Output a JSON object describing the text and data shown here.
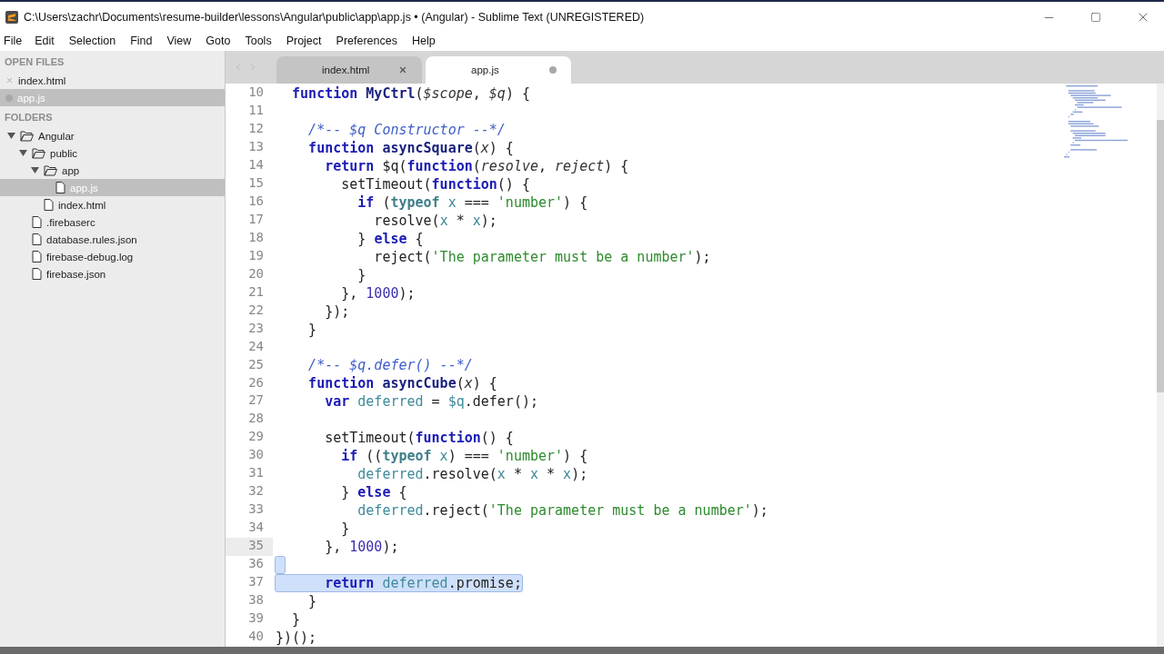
{
  "window": {
    "title": "C:\\Users\\zachr\\Documents\\resume-builder\\lessons\\Angular\\public\\app\\app.js • (Angular) - Sublime Text (UNREGISTERED)"
  },
  "menu": [
    "File",
    "Edit",
    "Selection",
    "Find",
    "View",
    "Goto",
    "Tools",
    "Project",
    "Preferences",
    "Help"
  ],
  "sidebar": {
    "open_files_heading": "OPEN FILES",
    "open_files": [
      {
        "name": "index.html",
        "selected": false,
        "dirty": false
      },
      {
        "name": "app.js",
        "selected": true,
        "dirty": true
      }
    ],
    "folders_heading": "FOLDERS",
    "folders": [
      {
        "name": "Angular",
        "kind": "folder",
        "expanded": true,
        "selected": false,
        "children": [
          {
            "name": "public",
            "kind": "folder",
            "expanded": true,
            "selected": false,
            "children": [
              {
                "name": "app",
                "kind": "folder",
                "expanded": true,
                "selected": false,
                "children": [
                  {
                    "name": "app.js",
                    "kind": "file",
                    "selected": true
                  }
                ]
              },
              {
                "name": "index.html",
                "kind": "file",
                "selected": false
              }
            ]
          },
          {
            "name": ".firebaserc",
            "kind": "file",
            "selected": false
          },
          {
            "name": "database.rules.json",
            "kind": "file",
            "selected": false
          },
          {
            "name": "firebase-debug.log",
            "kind": "file",
            "selected": false
          },
          {
            "name": "firebase.json",
            "kind": "file",
            "selected": false
          }
        ]
      }
    ]
  },
  "tabs": [
    {
      "label": "index.html",
      "selected": false,
      "dirty": false
    },
    {
      "label": "app.js",
      "selected": true,
      "dirty": true
    }
  ],
  "code": [
    {
      "number": "10",
      "current": false,
      "selected": false,
      "tokens": [
        {
          "kind": "kw",
          "text": "  function"
        },
        {
          "kind": "fn",
          "text": " MyCtrl"
        },
        {
          "kind": "p",
          "text": "("
        },
        {
          "kind": "param",
          "text": "$scope"
        },
        {
          "kind": "p",
          "text": ", "
        },
        {
          "kind": "param",
          "text": "$q"
        },
        {
          "kind": "p",
          "text": ") {"
        }
      ]
    },
    {
      "number": "11",
      "current": false,
      "selected": false
    },
    {
      "number": "12",
      "current": false,
      "selected": false,
      "tokens": [
        {
          "kind": "comment",
          "text": "    /*-- $q Constructor --*/"
        }
      ]
    },
    {
      "number": "13",
      "current": false,
      "selected": false,
      "tokens": [
        {
          "kind": "kw",
          "text": "    function"
        },
        {
          "kind": "fn",
          "text": " asyncSquare"
        },
        {
          "kind": "p",
          "text": "("
        },
        {
          "kind": "param",
          "text": "x"
        },
        {
          "kind": "p",
          "text": ") {"
        }
      ]
    },
    {
      "number": "14",
      "current": false,
      "selected": false,
      "tokens": [
        {
          "kind": "kw",
          "text": "      return"
        },
        {
          "kind": "p",
          "text": " $q("
        },
        {
          "kind": "kw",
          "text": "function"
        },
        {
          "kind": "p",
          "text": "("
        },
        {
          "kind": "param",
          "text": "resolve"
        },
        {
          "kind": "p",
          "text": ", "
        },
        {
          "kind": "param",
          "text": "reject"
        },
        {
          "kind": "p",
          "text": ") {"
        }
      ]
    },
    {
      "number": "15",
      "current": false,
      "selected": false,
      "tokens": [
        {
          "kind": "p",
          "text": "        setTimeout("
        },
        {
          "kind": "kw",
          "text": "function"
        },
        {
          "kind": "p",
          "text": "() {"
        }
      ]
    },
    {
      "number": "16",
      "current": false,
      "selected": false,
      "tokens": [
        {
          "kind": "kw",
          "text": "          if"
        },
        {
          "kind": "p",
          "text": " ("
        },
        {
          "kind": "op",
          "text": "typeof"
        },
        {
          "kind": "var",
          "text": " x"
        },
        {
          "kind": "p",
          "text": " === "
        },
        {
          "kind": "str",
          "text": "'number'"
        },
        {
          "kind": "p",
          "text": ") {"
        }
      ]
    },
    {
      "number": "17",
      "current": false,
      "selected": false,
      "tokens": [
        {
          "kind": "p",
          "text": "            resolve("
        },
        {
          "kind": "var",
          "text": "x"
        },
        {
          "kind": "p",
          "text": " * "
        },
        {
          "kind": "var",
          "text": "x"
        },
        {
          "kind": "p",
          "text": ");"
        }
      ]
    },
    {
      "number": "18",
      "current": false,
      "selected": false,
      "tokens": [
        {
          "kind": "p",
          "text": "          } "
        },
        {
          "kind": "kw",
          "text": "else"
        },
        {
          "kind": "p",
          "text": " {"
        }
      ]
    },
    {
      "number": "19",
      "current": false,
      "selected": false,
      "tokens": [
        {
          "kind": "p",
          "text": "            reject("
        },
        {
          "kind": "str",
          "text": "'The parameter must be a number'"
        },
        {
          "kind": "p",
          "text": ");"
        }
      ]
    },
    {
      "number": "20",
      "current": false,
      "selected": false,
      "tokens": [
        {
          "kind": "p",
          "text": "          }"
        }
      ]
    },
    {
      "number": "21",
      "current": false,
      "selected": false,
      "tokens": [
        {
          "kind": "p",
          "text": "        }, "
        },
        {
          "kind": "num",
          "text": "1000"
        },
        {
          "kind": "p",
          "text": ");"
        }
      ]
    },
    {
      "number": "22",
      "current": false,
      "selected": false,
      "tokens": [
        {
          "kind": "p",
          "text": "      });"
        }
      ]
    },
    {
      "number": "23",
      "current": false,
      "selected": false,
      "tokens": [
        {
          "kind": "p",
          "text": "    }"
        }
      ]
    },
    {
      "number": "24",
      "current": false,
      "selected": false
    },
    {
      "number": "25",
      "current": false,
      "selected": false,
      "tokens": [
        {
          "kind": "comment",
          "text": "    /*-- $q.defer() --*/"
        }
      ]
    },
    {
      "number": "26",
      "current": false,
      "selected": false,
      "tokens": [
        {
          "kind": "kw",
          "text": "    function"
        },
        {
          "kind": "fn",
          "text": " asyncCube"
        },
        {
          "kind": "p",
          "text": "("
        },
        {
          "kind": "param",
          "text": "x"
        },
        {
          "kind": "p",
          "text": ") {"
        }
      ]
    },
    {
      "number": "27",
      "current": false,
      "selected": false,
      "tokens": [
        {
          "kind": "kw",
          "text": "      var"
        },
        {
          "kind": "var",
          "text": " deferred"
        },
        {
          "kind": "p",
          "text": " = "
        },
        {
          "kind": "var",
          "text": "$q"
        },
        {
          "kind": "p",
          "text": ".defer();"
        }
      ]
    },
    {
      "number": "28",
      "current": false,
      "selected": false
    },
    {
      "number": "29",
      "current": false,
      "selected": false,
      "tokens": [
        {
          "kind": "p",
          "text": "      setTimeout("
        },
        {
          "kind": "kw",
          "text": "function"
        },
        {
          "kind": "p",
          "text": "() {"
        }
      ]
    },
    {
      "number": "30",
      "current": false,
      "selected": false,
      "tokens": [
        {
          "kind": "kw",
          "text": "        if"
        },
        {
          "kind": "p",
          "text": " (("
        },
        {
          "kind": "op",
          "text": "typeof"
        },
        {
          "kind": "var",
          "text": " x"
        },
        {
          "kind": "p",
          "text": ") === "
        },
        {
          "kind": "str",
          "text": "'number'"
        },
        {
          "kind": "p",
          "text": ") {"
        }
      ]
    },
    {
      "number": "31",
      "current": false,
      "selected": false,
      "tokens": [
        {
          "kind": "var",
          "text": "          deferred"
        },
        {
          "kind": "p",
          "text": ".resolve("
        },
        {
          "kind": "var",
          "text": "x"
        },
        {
          "kind": "p",
          "text": " * "
        },
        {
          "kind": "var",
          "text": "x"
        },
        {
          "kind": "p",
          "text": " * "
        },
        {
          "kind": "var",
          "text": "x"
        },
        {
          "kind": "p",
          "text": ");"
        }
      ]
    },
    {
      "number": "32",
      "current": false,
      "selected": false,
      "tokens": [
        {
          "kind": "p",
          "text": "        } "
        },
        {
          "kind": "kw",
          "text": "else"
        },
        {
          "kind": "p",
          "text": " {"
        }
      ]
    },
    {
      "number": "33",
      "current": false,
      "selected": false,
      "tokens": [
        {
          "kind": "var",
          "text": "          deferred"
        },
        {
          "kind": "p",
          "text": ".reject("
        },
        {
          "kind": "str",
          "text": "'The parameter must be a number'"
        },
        {
          "kind": "p",
          "text": ");"
        }
      ]
    },
    {
      "number": "34",
      "current": false,
      "selected": false,
      "tokens": [
        {
          "kind": "p",
          "text": "        }"
        }
      ]
    },
    {
      "number": "35",
      "current": true,
      "selected": false,
      "tokens": [
        {
          "kind": "p",
          "text": "      }, "
        },
        {
          "kind": "num",
          "text": "1000"
        },
        {
          "kind": "p",
          "text": ");"
        }
      ]
    },
    {
      "number": "36",
      "current": false,
      "selected": true
    },
    {
      "number": "37",
      "current": false,
      "selected": true,
      "tokens": [
        {
          "kind": "kw",
          "text": "      return"
        },
        {
          "kind": "var",
          "text": " deferred"
        },
        {
          "kind": "p",
          "text": ".promise;"
        }
      ]
    },
    {
      "number": "38",
      "current": false,
      "selected": false,
      "tokens": [
        {
          "kind": "p",
          "text": "    }"
        }
      ]
    },
    {
      "number": "39",
      "current": false,
      "selected": false,
      "tokens": [
        {
          "kind": "p",
          "text": "  }"
        }
      ]
    },
    {
      "number": "40",
      "current": false,
      "selected": false,
      "tokens": [
        {
          "kind": "p",
          "text": "})();"
        }
      ]
    }
  ]
}
